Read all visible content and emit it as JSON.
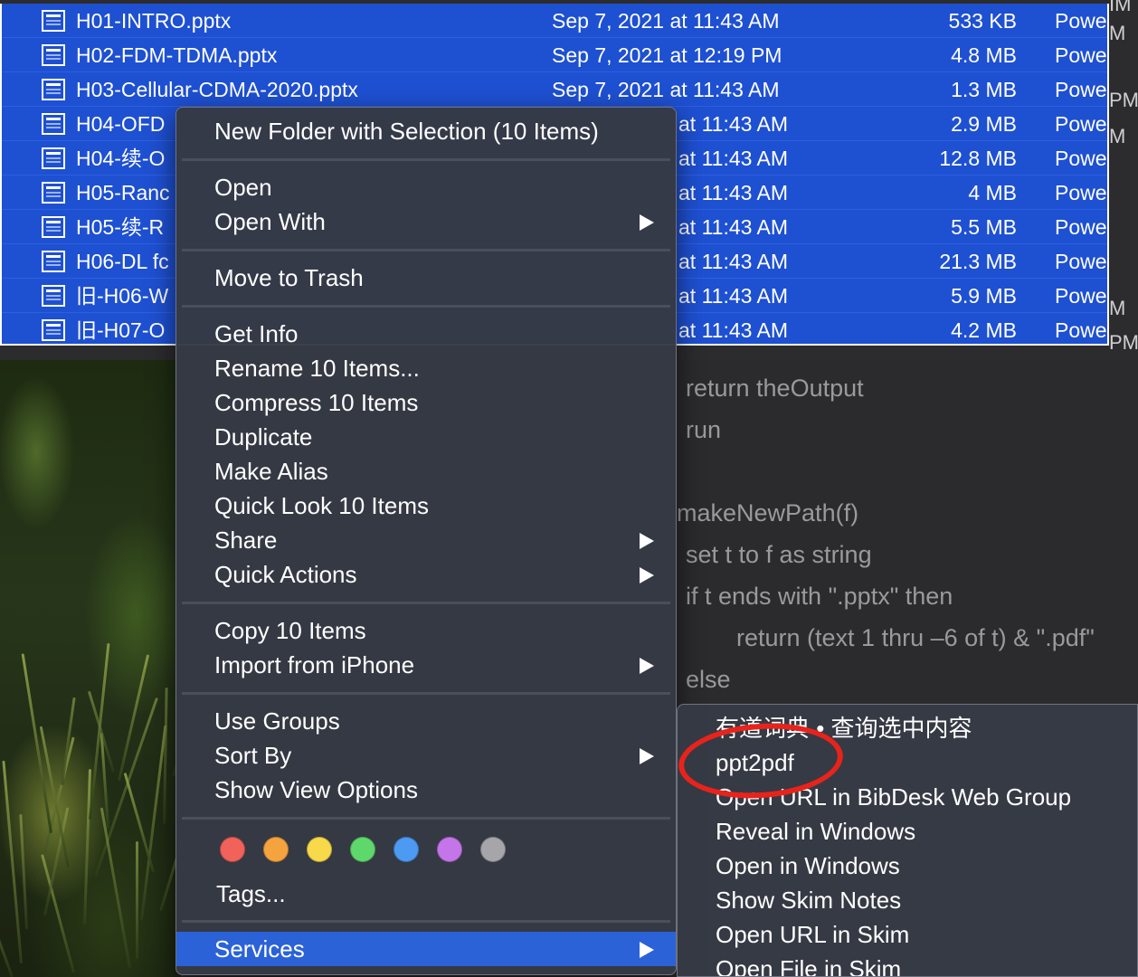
{
  "files": [
    {
      "name": "H01-INTRO.pptx",
      "date": "Sep 7, 2021 at 11:43 AM",
      "size": "533 KB",
      "kind": "Powe"
    },
    {
      "name": "H02-FDM-TDMA.pptx",
      "date": "Sep 7, 2021 at 12:19 PM",
      "size": "4.8 MB",
      "kind": "Powe"
    },
    {
      "name": "H03-Cellular-CDMA-2020.pptx",
      "date": "Sep 7, 2021 at 11:43 AM",
      "size": "1.3 MB",
      "kind": "Powe"
    },
    {
      "name": "H04-OFD",
      "date": "at 11:43 AM",
      "size": "2.9 MB",
      "kind": "Powe"
    },
    {
      "name": "H04-续-O",
      "date": "at 11:43 AM",
      "size": "12.8 MB",
      "kind": "Powe"
    },
    {
      "name": "H05-Ranc",
      "date": "at 11:43 AM",
      "size": "4 MB",
      "kind": "Powe"
    },
    {
      "name": "H05-续-R",
      "date": "at 11:43 AM",
      "size": "5.5 MB",
      "kind": "Powe"
    },
    {
      "name": "H06-DL fc",
      "date": "at 11:43 AM",
      "size": "21.3 MB",
      "kind": "Powe"
    },
    {
      "name": "旧-H06-W",
      "date": "at 11:43 AM",
      "size": "5.9 MB",
      "kind": "Powe"
    },
    {
      "name": "旧-H07-O",
      "date": "at 11:43 AM",
      "size": "4.2 MB",
      "kind": "Powe"
    }
  ],
  "edge_fragments": [
    "IM",
    "M",
    "PM",
    "M",
    "M",
    "PM"
  ],
  "code_lines": [
    "return theOutput",
    "run",
    "makeNewPath(f)",
    "set t to f as string",
    "if t ends with \".pptx\" then",
    "return (text 1 thru –6 of t) & \".pdf\"",
    "else"
  ],
  "menu": {
    "new_folder": "New Folder with Selection (10 Items)",
    "open": "Open",
    "open_with": "Open With",
    "move_to_trash": "Move to Trash",
    "get_info": "Get Info",
    "rename": "Rename 10 Items...",
    "compress": "Compress 10 Items",
    "duplicate": "Duplicate",
    "make_alias": "Make Alias",
    "quick_look": "Quick Look 10 Items",
    "share": "Share",
    "quick_actions": "Quick Actions",
    "copy": "Copy 10 Items",
    "import_iphone": "Import from iPhone",
    "use_groups": "Use Groups",
    "sort_by": "Sort By",
    "show_view_options": "Show View Options",
    "tags": "Tags...",
    "services": "Services"
  },
  "tag_colors": [
    "#f0625a",
    "#f5a33f",
    "#f7d94a",
    "#5fd86b",
    "#4c9af2",
    "#c575ea",
    "#a6a6aa"
  ],
  "services": [
    "有道词典 • 查询选中内容",
    "ppt2pdf",
    "Open URL in BibDesk Web Group",
    "Reveal in Windows",
    "Open in Windows",
    "Show Skim Notes",
    "Open URL in Skim",
    "Open File in Skim"
  ],
  "colors": {
    "selection": "#1e50d2",
    "menu_highlight": "#2b62d7",
    "annotation": "#e8231b"
  }
}
